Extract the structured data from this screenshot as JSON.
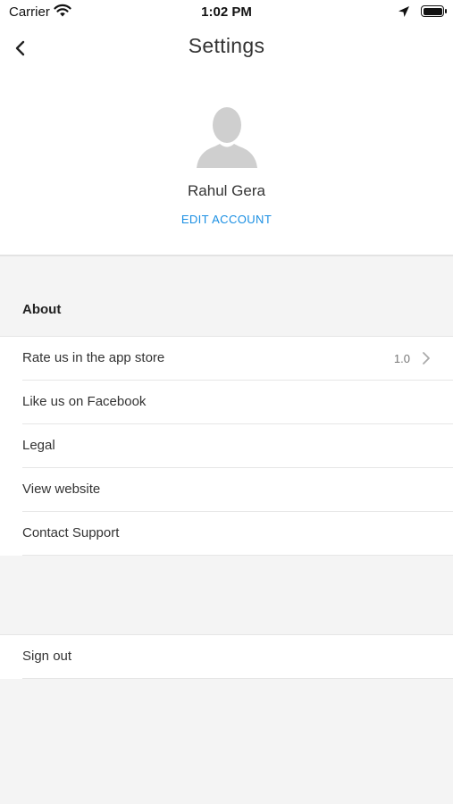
{
  "status_bar": {
    "carrier": "Carrier",
    "time": "1:02 PM",
    "icons": [
      "wifi-icon",
      "location-arrow-icon",
      "battery-icon"
    ]
  },
  "nav": {
    "title": "Settings",
    "back_icon": "chevron-left-icon"
  },
  "profile": {
    "avatar_icon": "user-silhouette-icon",
    "name": "Rahul Gera",
    "edit_label": "EDIT ACCOUNT"
  },
  "about": {
    "header": "About",
    "items": [
      {
        "label": "Rate us in the app store",
        "value": "1.0",
        "icon": "chevron-right-icon"
      },
      {
        "label": "Like us on Facebook"
      },
      {
        "label": "Legal"
      },
      {
        "label": "View website"
      },
      {
        "label": "Contact Support"
      }
    ]
  },
  "account": {
    "sign_out_label": "Sign out"
  },
  "colors": {
    "accent": "#1a8fe3",
    "background": "#f4f4f4",
    "surface": "#ffffff",
    "divider": "#e6e6e6"
  }
}
